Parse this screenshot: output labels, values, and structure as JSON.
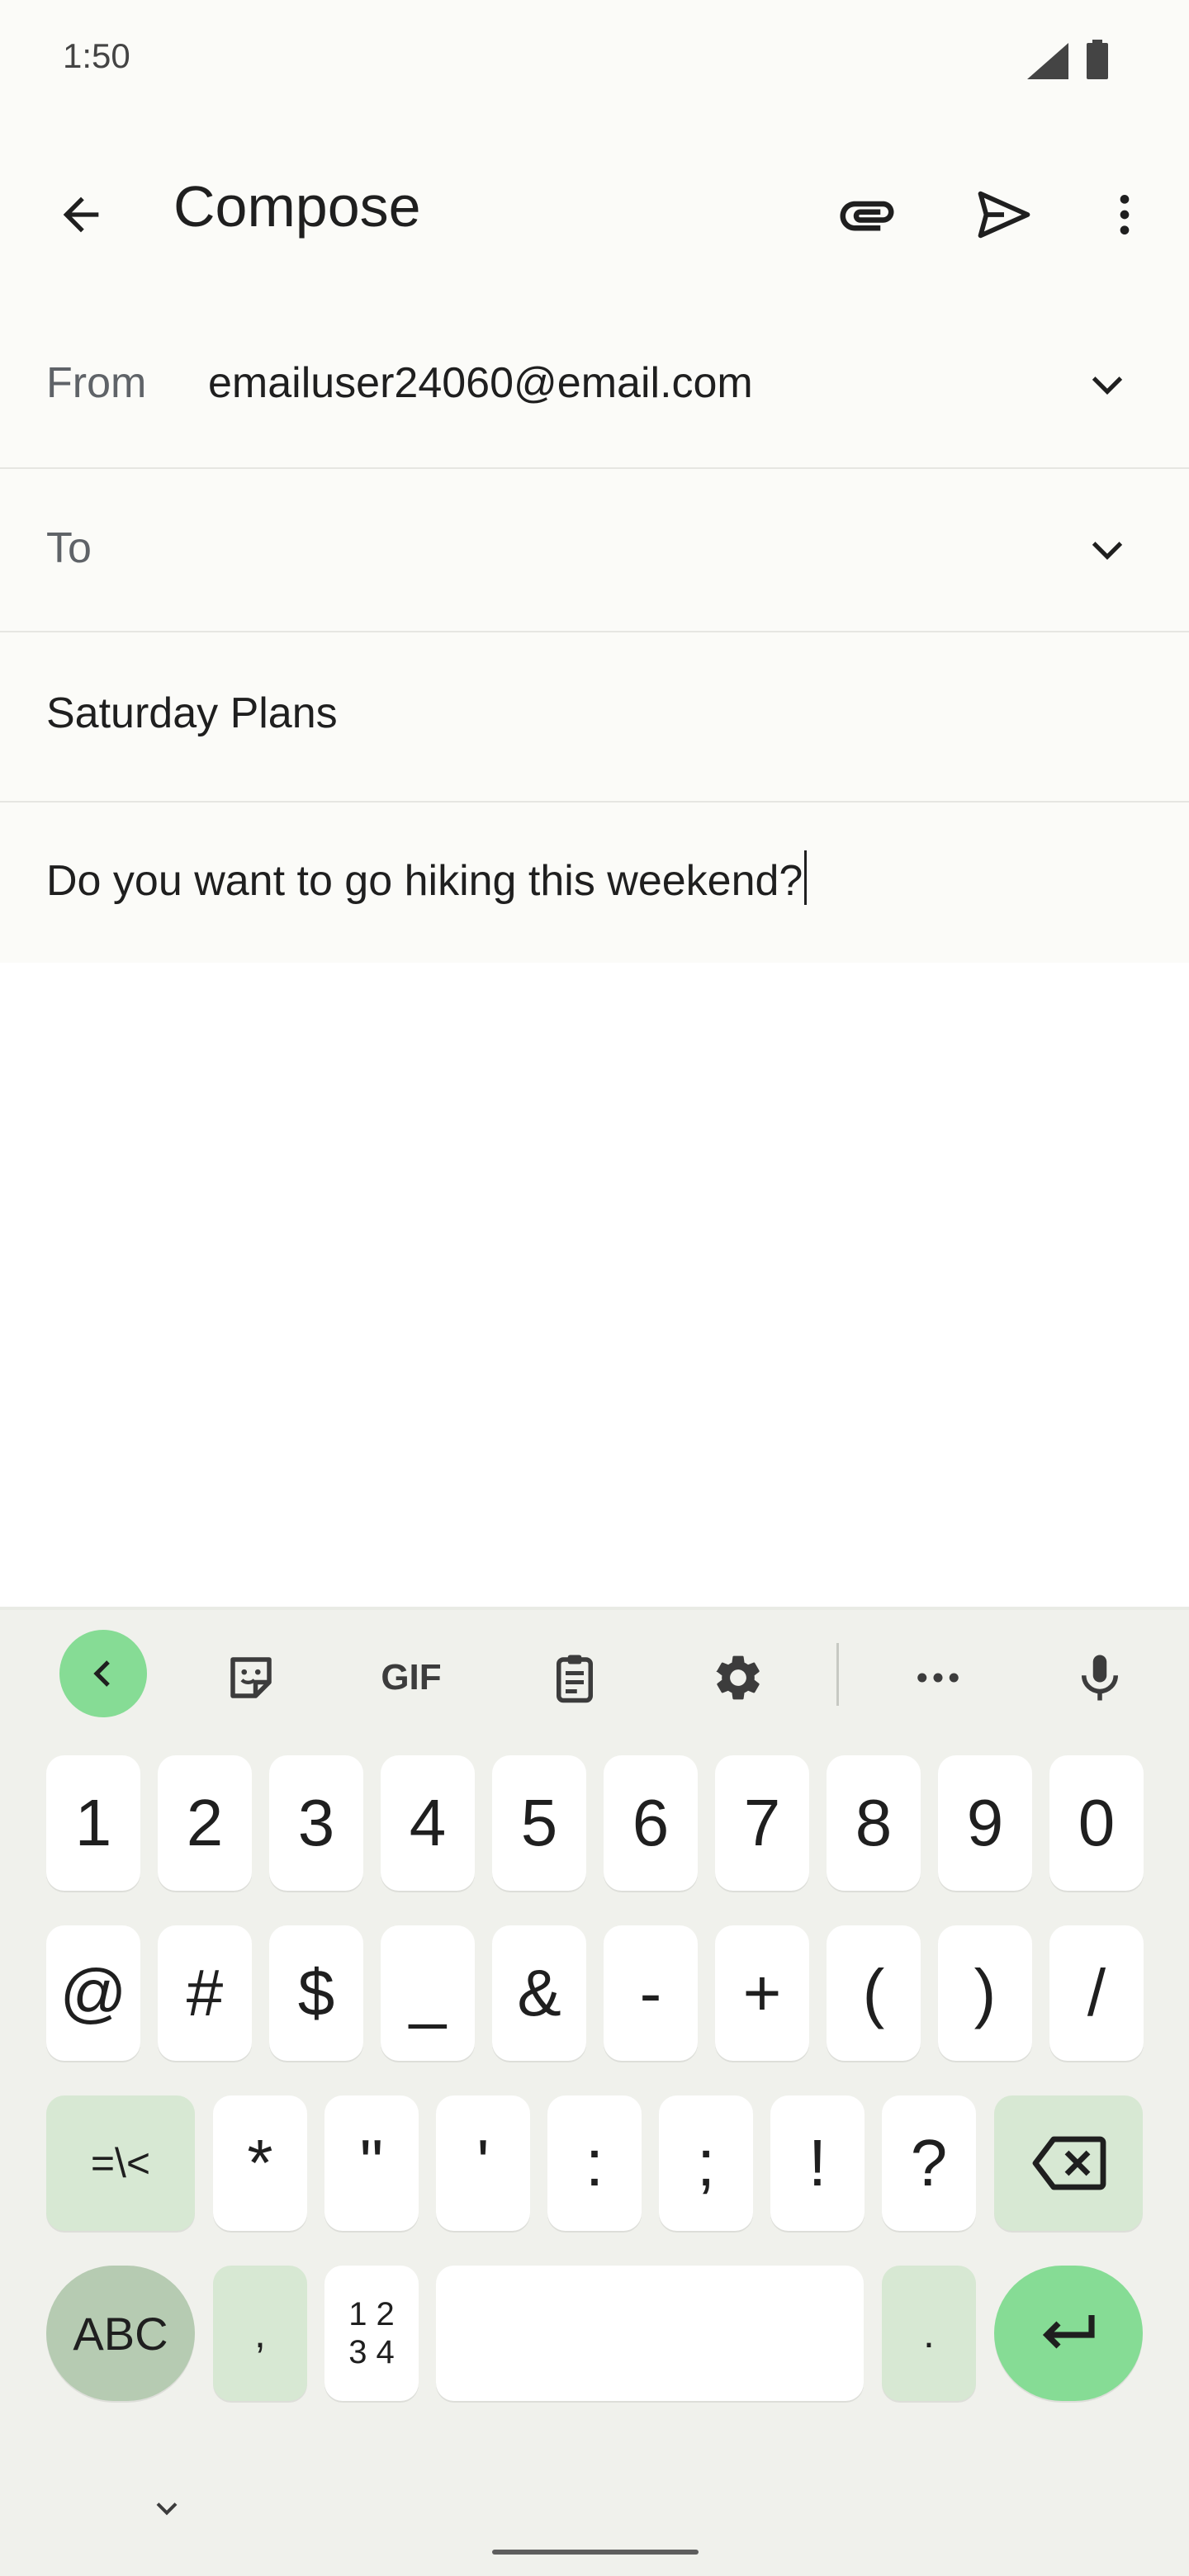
{
  "status_bar": {
    "time": "1:50"
  },
  "app_bar": {
    "title": "Compose",
    "back_icon": "arrow-left-icon",
    "attach_icon": "paperclip-icon",
    "send_icon": "send-icon",
    "menu_icon": "more-vert-icon"
  },
  "form": {
    "from_label": "From",
    "from_value": "emailuser24060@email.com",
    "to_label": "To",
    "subject": "Saturday Plans",
    "body": "Do you want to go hiking this weekend?"
  },
  "keyboard": {
    "toolbar": [
      "chevron-left-icon",
      "sticker-icon",
      "GIF",
      "clipboard-icon",
      "gear-icon",
      "more-horiz-icon",
      "mic-icon"
    ],
    "row1": [
      "1",
      "2",
      "3",
      "4",
      "5",
      "6",
      "7",
      "8",
      "9",
      "0"
    ],
    "row2": [
      "@",
      "#",
      "$",
      "_",
      "&",
      "-",
      "+",
      "(",
      ")",
      "/"
    ],
    "row3": [
      "=\\<",
      "*",
      "\"",
      "'",
      ":",
      ";",
      "!",
      "?"
    ],
    "row4": {
      "abc": "ABC",
      "comma": ",",
      "numpad_top": "1 2",
      "numpad_bottom": "3 4",
      "period": "."
    },
    "accent_color": "#86dc95"
  }
}
